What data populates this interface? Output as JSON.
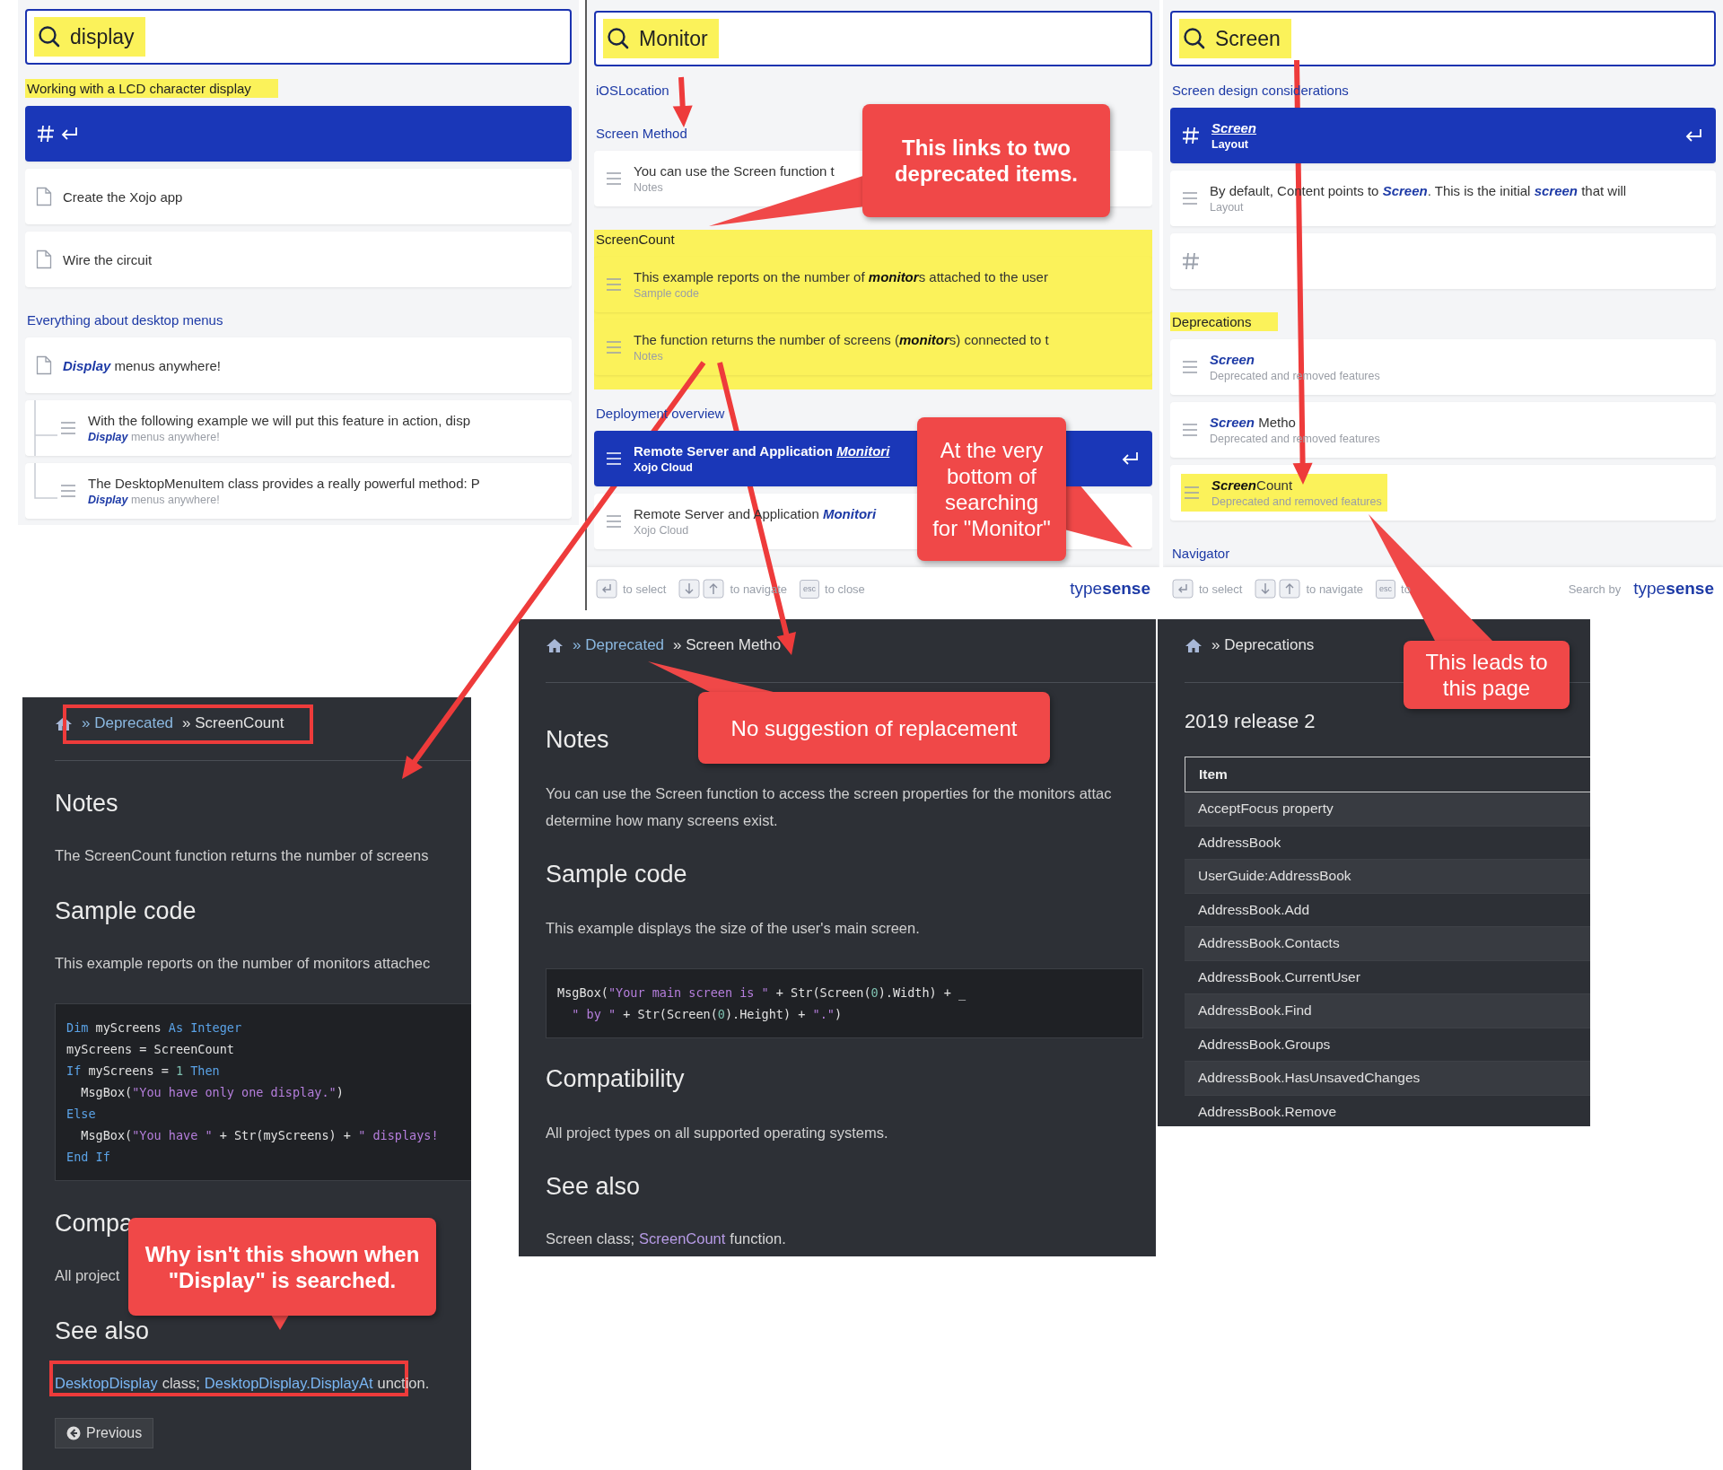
{
  "search_panels": [
    {
      "query": "display",
      "query_highlighted": true,
      "groups": [
        {
          "heading": "Working with a LCD character display",
          "heading_highlighted": true,
          "group_highlighted": false,
          "hits": [
            {
              "kind": "section",
              "selected": true,
              "highlighted": false
            },
            {
              "kind": "page",
              "selected": false,
              "highlighted": false,
              "title": "Create the Xojo app"
            },
            {
              "kind": "page",
              "selected": false,
              "highlighted": false,
              "title": "Wire the circuit"
            }
          ]
        },
        {
          "heading": "Everything about desktop menus",
          "heading_highlighted": false,
          "group_highlighted": false,
          "hits": [
            {
              "kind": "page",
              "selected": false,
              "highlighted": false,
              "title": "*Display* menus anywhere!",
              "children": [
                {
                  "kind": "content",
                  "selected": false,
                  "highlighted": false,
                  "title": "With the following example we will put this feature in action, disp",
                  "subtitle": "*Display* menus anywhere!"
                },
                {
                  "kind": "content",
                  "selected": false,
                  "highlighted": false,
                  "title": "The DesktopMenuItem class provides a really powerful method: P",
                  "subtitle": "*Display* menus anywhere!"
                }
              ]
            }
          ]
        }
      ]
    },
    {
      "query": "Monitor",
      "query_highlighted": true,
      "groups": [
        {
          "heading": "iOSLocation",
          "heading_highlighted": false,
          "group_highlighted": false
        },
        {
          "heading": "Screen Method",
          "heading_highlighted": false,
          "group_highlighted": false,
          "hits": [
            {
              "kind": "content",
              "selected": false,
              "highlighted": false,
              "title": "You can use the Screen function t",
              "subtitle": "Notes"
            }
          ]
        },
        {
          "heading": "ScreenCount",
          "heading_highlighted": false,
          "group_highlighted": true,
          "hits": [
            {
              "kind": "content",
              "selected": false,
              "highlighted": false,
              "title": [
                {
                  "text": "This example reports on the number of ",
                  "match": false
                },
                {
                  "text": "monitor",
                  "match": true
                },
                {
                  "text": "s attached to the user",
                  "match": false
                }
              ],
              "subtitle": "Sample code"
            },
            {
              "kind": "content",
              "selected": false,
              "highlighted": false,
              "title": [
                {
                  "text": "The function returns the number of screens (",
                  "match": false
                },
                {
                  "text": "monitor",
                  "match": true
                },
                {
                  "text": "s) connected to t",
                  "match": false
                }
              ],
              "subtitle": "Notes"
            }
          ]
        },
        {
          "heading": "Deployment overview",
          "heading_highlighted": false,
          "group_highlighted": false,
          "hits": [
            {
              "kind": "content",
              "selected": true,
              "highlighted": false,
              "title": "Remote Server and Application *Monitori*",
              "subtitle": "Xojo Cloud"
            },
            {
              "kind": "content",
              "selected": false,
              "highlighted": false,
              "title": "Remote Server and Application *Monitori*",
              "subtitle": "Xojo Cloud"
            }
          ]
        }
      ],
      "footer": {
        "hints": [
          {
            "keys": [
              {
                "kind": "enter"
              }
            ],
            "label": "to select"
          },
          {
            "keys": [
              {
                "kind": "down"
              },
              {
                "kind": "up"
              }
            ],
            "label": "to navigate"
          },
          {
            "keys": [
              {
                "kind": "esc",
                "text": "esc"
              }
            ],
            "label": "to close"
          }
        ],
        "brand": "type**sense**"
      }
    },
    {
      "query": "Screen",
      "query_highlighted": true,
      "groups": [
        {
          "heading": "Screen design considerations",
          "heading_highlighted": false,
          "group_highlighted": false,
          "hits": [
            {
              "kind": "section",
              "selected": true,
              "highlighted": false,
              "title": "*Screen*",
              "subtitle": "Layout"
            },
            {
              "kind": "content",
              "selected": false,
              "highlighted": false,
              "title": "By default, Content points to *Screen*. This is the initial *screen* that will",
              "subtitle": "Layout"
            },
            {
              "kind": "section",
              "selected": false,
              "highlighted": false
            }
          ]
        },
        {
          "heading": "Deprecations",
          "heading_highlighted": true,
          "group_highlighted": false,
          "hits": [
            {
              "kind": "content",
              "selected": false,
              "highlighted": false,
              "title": "*Screen*",
              "subtitle": "Deprecated and removed features"
            },
            {
              "kind": "content",
              "selected": false,
              "highlighted": false,
              "title": "*Screen* Metho",
              "subtitle": "Deprecated and removed features"
            },
            {
              "kind": "content",
              "selected": false,
              "highlighted": true,
              "title": [
                {
                  "text": "Screen",
                  "match": true
                },
                {
                  "text": "Count",
                  "match": false
                }
              ],
              "subtitle": "Deprecated and removed features"
            }
          ]
        },
        {
          "heading": "Navigator",
          "heading_highlighted": false,
          "group_highlighted": false
        }
      ],
      "footer": {
        "hints": [
          {
            "keys": [
              {
                "kind": "enter"
              }
            ],
            "label": "to select"
          },
          {
            "keys": [
              {
                "kind": "down"
              },
              {
                "kind": "up"
              }
            ],
            "label": "to navigate"
          },
          {
            "keys": [
              {
                "kind": "esc",
                "text": "esc"
              }
            ],
            "label": "to"
          }
        ],
        "search_by": "Search by",
        "brand": "type**sense**"
      }
    }
  ],
  "doc_pages": [
    {
      "breadcrumb": [
        {
          "kind": "home"
        },
        {
          "kind": "link",
          "text": "» Deprecated"
        },
        {
          "kind": "text",
          "text": "» ScreenCount"
        }
      ],
      "blocks": [
        {
          "kind": "heading",
          "text": "Notes"
        },
        {
          "kind": "para",
          "lines": [
            "The ScreenCount function returns the number of screens"
          ]
        },
        {
          "kind": "heading",
          "text": "Sample code"
        },
        {
          "kind": "para",
          "lines": [
            "This example reports on the number of monitors attachec"
          ]
        },
        {
          "kind": "code",
          "lines": [
            [
              {
                "kind": "kw",
                "text": "Dim"
              },
              {
                "kind": "plain",
                "text": " myScreens "
              },
              {
                "kind": "kw",
                "text": "As Integer"
              }
            ],
            [
              {
                "kind": "plain",
                "text": "myScreens = ScreenCount"
              }
            ],
            [
              {
                "kind": "kw",
                "text": "If"
              },
              {
                "kind": "plain",
                "text": " myScreens = "
              },
              {
                "kind": "num",
                "text": "1"
              },
              {
                "kind": "kw",
                "text": " Then"
              }
            ],
            [
              {
                "kind": "plain",
                "text": "  MsgBox("
              },
              {
                "kind": "str",
                "text": "\"You have only one display.\""
              },
              {
                "kind": "plain",
                "text": ")"
              }
            ],
            [
              {
                "kind": "kw",
                "text": "Else"
              }
            ],
            [
              {
                "kind": "plain",
                "text": "  MsgBox("
              },
              {
                "kind": "str",
                "text": "\"You have \""
              },
              {
                "kind": "plain",
                "text": " + Str(myScreens) + "
              },
              {
                "kind": "str",
                "text": "\" displays!"
              }
            ],
            [
              {
                "kind": "kw",
                "text": "End If"
              }
            ]
          ]
        },
        {
          "kind": "heading",
          "text": "Compa"
        },
        {
          "kind": "para",
          "lines": [
            "All project"
          ]
        },
        {
          "kind": "heading",
          "text": "See also"
        },
        {
          "kind": "links",
          "parts": [
            {
              "kind": "link",
              "text": "DesktopDisplay"
            },
            {
              "kind": "text",
              "text": "class;"
            },
            {
              "kind": "link",
              "text": "DesktopDisplay.DisplayAt"
            },
            {
              "kind": "text",
              "text": "unction."
            }
          ]
        },
        {
          "kind": "button",
          "text": "Previous"
        }
      ]
    },
    {
      "breadcrumb": [
        {
          "kind": "home"
        },
        {
          "kind": "link",
          "text": "» Deprecated"
        },
        {
          "kind": "text",
          "text": "» Screen Metho"
        }
      ],
      "blocks": [
        {
          "kind": "heading",
          "text": "Notes"
        },
        {
          "kind": "para",
          "lines": [
            "You can use the Screen function to access the screen properties for the monitors attac",
            "determine how many screens exist."
          ]
        },
        {
          "kind": "heading",
          "text": "Sample code"
        },
        {
          "kind": "para",
          "lines": [
            "This example displays the size of the user's main screen."
          ]
        },
        {
          "kind": "code",
          "lines": [
            [
              {
                "kind": "plain",
                "text": "MsgBox("
              },
              {
                "kind": "str",
                "text": "\"Your main screen is \""
              },
              {
                "kind": "plain",
                "text": " + Str(Screen("
              },
              {
                "kind": "num",
                "text": "0"
              },
              {
                "kind": "plain",
                "text": ").Width) + _"
              }
            ],
            [
              {
                "kind": "str",
                "text": "  \" by \""
              },
              {
                "kind": "plain",
                "text": " + Str(Screen("
              },
              {
                "kind": "num",
                "text": "0"
              },
              {
                "kind": "plain",
                "text": ").Height) + "
              },
              {
                "kind": "str",
                "text": "\".\""
              },
              {
                "kind": "plain",
                "text": ")"
              }
            ]
          ]
        },
        {
          "kind": "heading",
          "text": "Compatibility"
        },
        {
          "kind": "para",
          "lines": [
            "All project types on all supported operating systems."
          ]
        },
        {
          "kind": "heading",
          "text": "See also"
        },
        {
          "kind": "links",
          "parts": [
            {
              "kind": "text",
              "text": "Screen class;"
            },
            {
              "kind": "visited",
              "text": "ScreenCount"
            },
            {
              "kind": "text",
              "text": "function."
            }
          ]
        }
      ]
    },
    {
      "breadcrumb": [
        {
          "kind": "home"
        },
        {
          "kind": "text",
          "text": "» Deprecations"
        }
      ],
      "blocks": [
        {
          "kind": "subheading",
          "text": "2019 release 2"
        },
        {
          "kind": "table",
          "columns": [
            "Item"
          ],
          "rows": [
            "AcceptFocus property",
            "AddressBook",
            "UserGuide:AddressBook",
            "AddressBook.Add",
            "AddressBook.Contacts",
            "AddressBook.CurrentUser",
            "AddressBook.Find",
            "AddressBook.Groups",
            "AddressBook.HasUnsavedChanges",
            "AddressBook.Remove"
          ]
        }
      ]
    }
  ],
  "callouts": [
    {
      "text": "This links to two deprecated items.",
      "bold": true
    },
    {
      "text": "At the very bottom of searching for \"Monitor\"",
      "bold": false
    },
    {
      "text": "No suggestion of replacement",
      "bold": false
    },
    {
      "text": "This leads to this page",
      "bold": false
    },
    {
      "text": "Why isn't this shown when \"Display\" is searched.",
      "bold": true
    }
  ]
}
